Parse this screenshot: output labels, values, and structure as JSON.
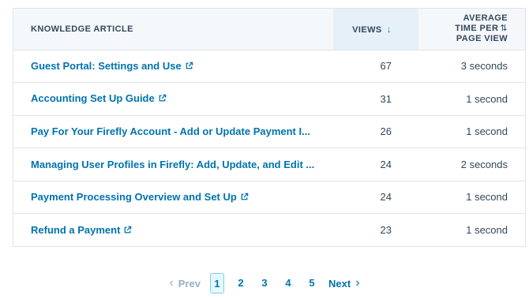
{
  "table": {
    "headers": {
      "article": "KNOWLEDGE ARTICLE",
      "views": "VIEWS",
      "time_line1": "AVERAGE",
      "time_line2": "TIME PER",
      "time_line3": "PAGE VIEW"
    },
    "sort_icons": {
      "views": "↓",
      "time": "⇅"
    },
    "rows": [
      {
        "article": "Guest Portal: Settings and Use",
        "external": true,
        "views": "67",
        "time": "3 seconds"
      },
      {
        "article": "Accounting Set Up Guide",
        "external": true,
        "views": "31",
        "time": "1 second"
      },
      {
        "article": "Pay For Your Firefly Account - Add or Update Payment I...",
        "external": false,
        "views": "26",
        "time": "1 second"
      },
      {
        "article": "Managing User Profiles in Firefly: Add, Update, and Edit ...",
        "external": false,
        "views": "24",
        "time": "2 seconds"
      },
      {
        "article": "Payment Processing Overview and Set Up",
        "external": true,
        "views": "24",
        "time": "1 second"
      },
      {
        "article": "Refund a Payment",
        "external": true,
        "views": "23",
        "time": "1 second"
      }
    ]
  },
  "pagination": {
    "prev_label": "Prev",
    "next_label": "Next",
    "pages": [
      "1",
      "2",
      "3",
      "4",
      "5"
    ],
    "active_page": "1"
  },
  "colors": {
    "link": "#0073ae",
    "header_bg": "#f5f8fa",
    "sorted_header_bg": "#e5f0f8",
    "border": "#dfe3eb"
  },
  "icons": {
    "external": "external-link-icon",
    "prev": "chevron-left-icon",
    "next": "chevron-right-icon"
  }
}
